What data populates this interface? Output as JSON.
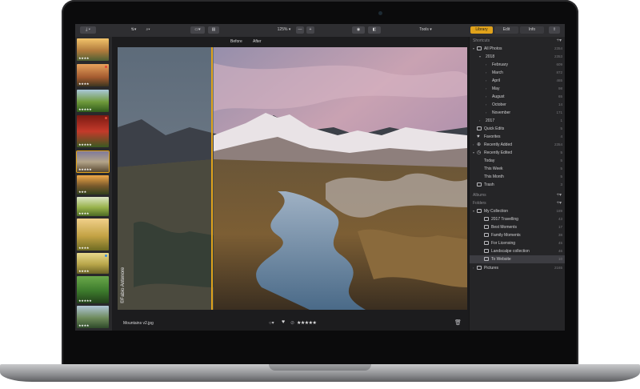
{
  "toolbar": {
    "zoom_label": "125%",
    "zoom_minus": "—",
    "zoom_plus": "+",
    "tools_label": "Tools",
    "tabs": [
      {
        "label": "Library",
        "active": true
      },
      {
        "label": "Edit",
        "active": false
      },
      {
        "label": "Info",
        "active": false
      }
    ],
    "accent_color": "#e0a21b"
  },
  "viewer": {
    "before_label": "Before",
    "after_label": "After",
    "watermark": "©Fabio Antenore",
    "filename": "Mountains v2.jpg",
    "rating_stars": "★★★★★"
  },
  "filmstrip": {
    "thumbs": [
      {
        "stars": "★★★★"
      },
      {
        "stars": "★★★★"
      },
      {
        "stars": "★★★★★"
      },
      {
        "stars": "★★★★★"
      },
      {
        "stars": "★★★★★"
      },
      {
        "stars": "★★★"
      },
      {
        "stars": "★★★★"
      },
      {
        "stars": "★★★★"
      },
      {
        "stars": "★★★★"
      },
      {
        "stars": "★★★★★"
      },
      {
        "stars": "★★★★"
      }
    ]
  },
  "sidebar": {
    "shortcuts_header": "Shortcuts",
    "all_photos": {
      "label": "All Photos",
      "count": "2354"
    },
    "year_2018": {
      "label": "2018",
      "count": "2353"
    },
    "months": [
      {
        "label": "February",
        "count": "609"
      },
      {
        "label": "March",
        "count": "872"
      },
      {
        "label": "April",
        "count": "465"
      },
      {
        "label": "May",
        "count": "98"
      },
      {
        "label": "August",
        "count": "65"
      },
      {
        "label": "October",
        "count": "14"
      },
      {
        "label": "November",
        "count": "171"
      }
    ],
    "year_2017": {
      "label": "2017",
      "count": "1"
    },
    "quick_edits": {
      "label": "Quick Edits",
      "count": "5"
    },
    "favorites": {
      "label": "Favorites",
      "count": "4"
    },
    "recently_added": {
      "label": "Recently Added",
      "count": "2354"
    },
    "recently_edited": {
      "label": "Recently Edited",
      "count": "5"
    },
    "today": {
      "label": "Today",
      "count": "5"
    },
    "this_week": {
      "label": "This Week",
      "count": "5"
    },
    "this_month": {
      "label": "This Month",
      "count": "5"
    },
    "trash": {
      "label": "Trash",
      "count": "3"
    },
    "albums_header": "Albums",
    "folders_header": "Folders",
    "my_collection": {
      "label": "My Collection",
      "count": "189"
    },
    "folders": [
      {
        "label": "2017 Travelling",
        "count": "43"
      },
      {
        "label": "Best Moments",
        "count": "17"
      },
      {
        "label": "Family Moments",
        "count": "38"
      },
      {
        "label": "For Licensing",
        "count": "45"
      },
      {
        "label": "Landscalpe collection",
        "count": "46"
      },
      {
        "label": "To Website",
        "count": "10"
      }
    ],
    "pictures": {
      "label": "Pictures",
      "count": "2165"
    }
  }
}
